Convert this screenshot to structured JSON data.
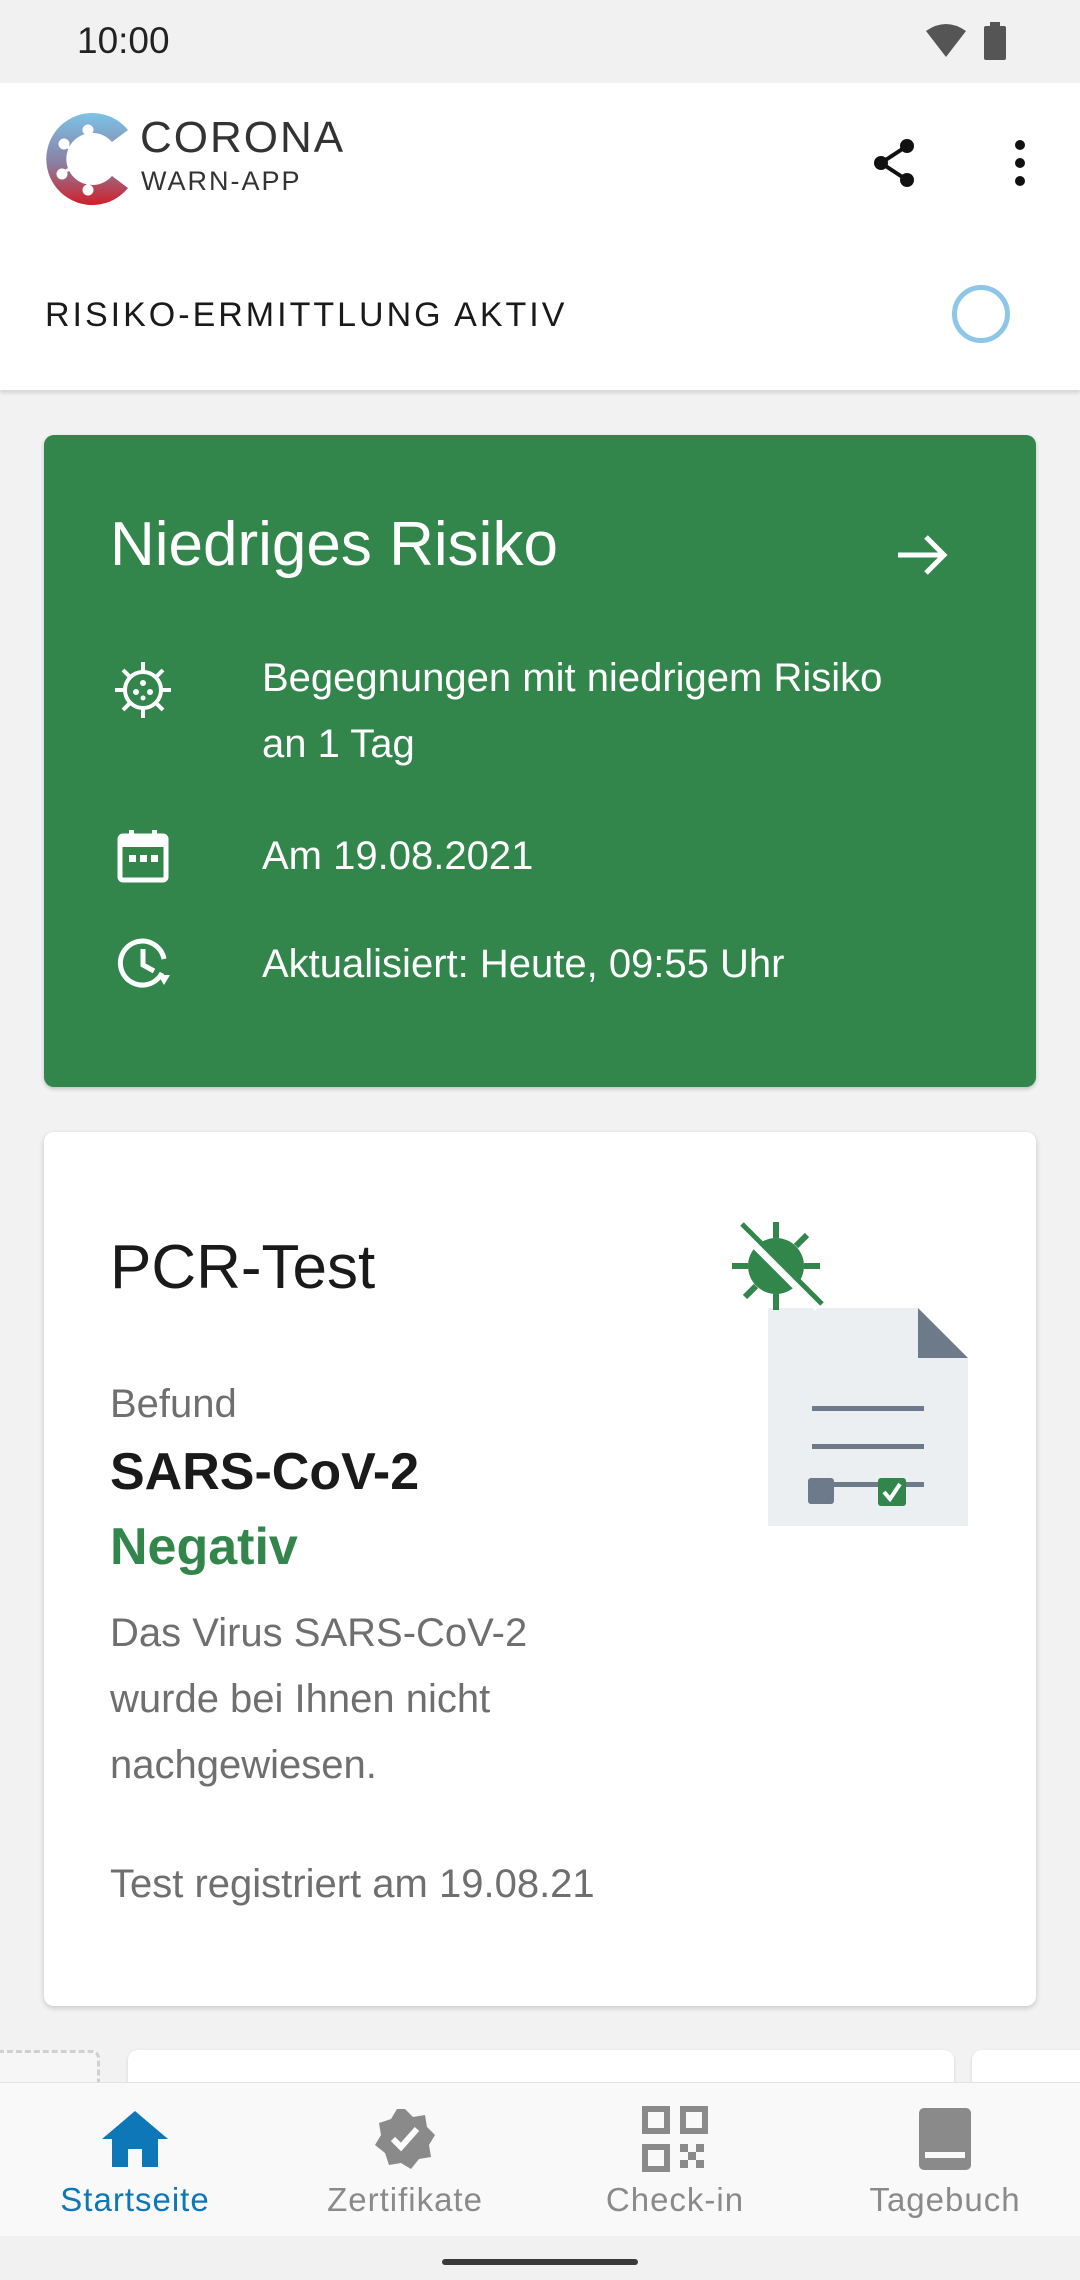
{
  "status_bar": {
    "time": "10:00"
  },
  "app_bar": {
    "brand_title": "CORONA",
    "brand_subtitle": "WARN-APP",
    "risk_status_label": "RISIKO-ERMITTLUNG AKTIV"
  },
  "risk_card": {
    "title": "Niedriges Risiko",
    "rows": [
      {
        "icon": "virus-icon",
        "text_line1": "Begegnungen mit niedrigem Risiko",
        "text_line2": "an 1 Tag"
      },
      {
        "icon": "calendar-icon",
        "text": "Am 19.08.2021"
      },
      {
        "icon": "clock-refresh-icon",
        "text": "Aktualisiert: Heute, 09:55 Uhr"
      }
    ],
    "color": "#32854b"
  },
  "test_card": {
    "title": "PCR-Test",
    "befund_label": "Befund",
    "virus_name": "SARS-CoV-2",
    "result": "Negativ",
    "description_line1": "Das Virus SARS-CoV-2",
    "description_line2": "wurde bei Ihnen nicht",
    "description_line3": "nachgewiesen.",
    "registered": "Test registriert am 19.08.21",
    "result_color": "#32854b"
  },
  "bottom_nav": {
    "items": [
      {
        "label": "Startseite",
        "icon": "home-icon",
        "active": true
      },
      {
        "label": "Zertifikate",
        "icon": "certificate-icon",
        "active": false
      },
      {
        "label": "Check-in",
        "icon": "qr-code-icon",
        "active": false
      },
      {
        "label": "Tagebuch",
        "icon": "book-icon",
        "active": false
      }
    ],
    "active_color": "#0d77b8"
  }
}
